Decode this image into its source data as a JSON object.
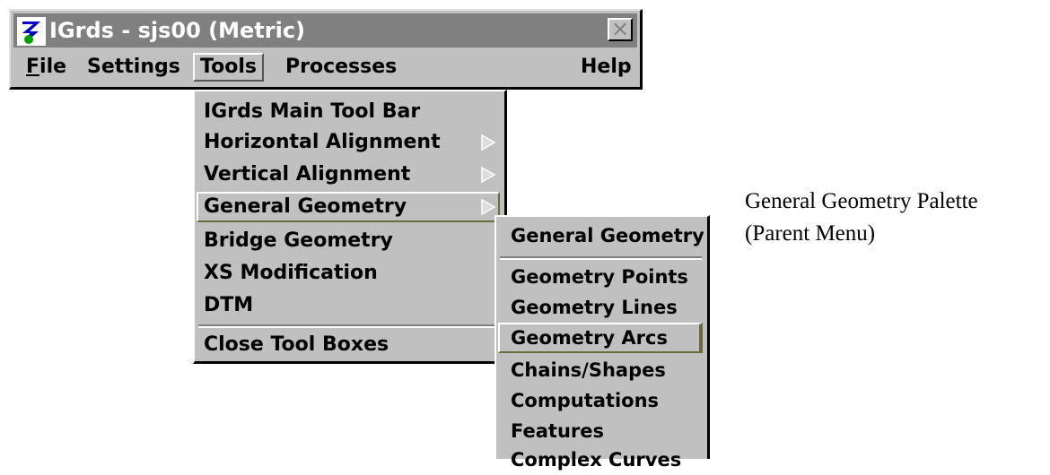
{
  "window": {
    "title": "IGrds - sjs00 (Metric)",
    "close_glyph": "×",
    "app_icon": "igrds-app-icon"
  },
  "menubar": {
    "file": "File",
    "settings": "Settings",
    "tools": "Tools",
    "processes": "Processes",
    "help": "Help"
  },
  "tools_menu": {
    "items": [
      "IGrds Main Tool Bar",
      "Horizontal Alignment",
      "Vertical Alignment",
      "General Geometry",
      "Bridge Geometry",
      "XS Modification",
      "DTM",
      "Close Tool Boxes"
    ],
    "submenu_icon": "chevron-right-icon"
  },
  "general_geometry_submenu": {
    "header": "General Geometry",
    "items": [
      "Geometry Points",
      "Geometry Lines",
      "Geometry Arcs",
      "Chains/Shapes",
      "Computations",
      "Features",
      "Complex Curves"
    ],
    "highlighted": "Geometry Arcs"
  },
  "annotation": {
    "line1": "General Geometry Palette",
    "line2": "(Parent Menu)"
  },
  "colors": {
    "titlebar": "#808080",
    "menu_face": "#c0c0c0",
    "highlight_shadow": "#6b6b3a"
  }
}
